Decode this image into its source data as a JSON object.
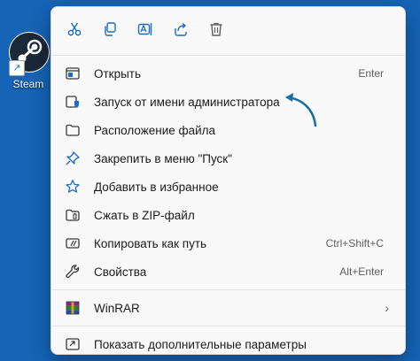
{
  "desktop": {
    "icon_label": "Steam"
  },
  "quick_actions": [
    "cut",
    "copy",
    "rename",
    "share",
    "delete"
  ],
  "menu": {
    "open": {
      "label": "Открыть",
      "shortcut": "Enter"
    },
    "run_as_admin": {
      "label": "Запуск от имени администратора"
    },
    "file_location": {
      "label": "Расположение файла"
    },
    "pin_start": {
      "label": "Закрепить в меню \"Пуск\""
    },
    "add_favorites": {
      "label": "Добавить в избранное"
    },
    "zip": {
      "label": "Сжать в ZIP-файл"
    },
    "copy_path": {
      "label": "Копировать как путь",
      "shortcut": "Ctrl+Shift+C"
    },
    "properties": {
      "label": "Свойства",
      "shortcut": "Alt+Enter"
    },
    "winrar": {
      "label": "WinRAR"
    },
    "more_options": {
      "label": "Показать дополнительные параметры"
    }
  },
  "colors": {
    "desktop": "#1664b6",
    "accent": "#1c6ac9",
    "annotation": "#1a6fa6"
  }
}
